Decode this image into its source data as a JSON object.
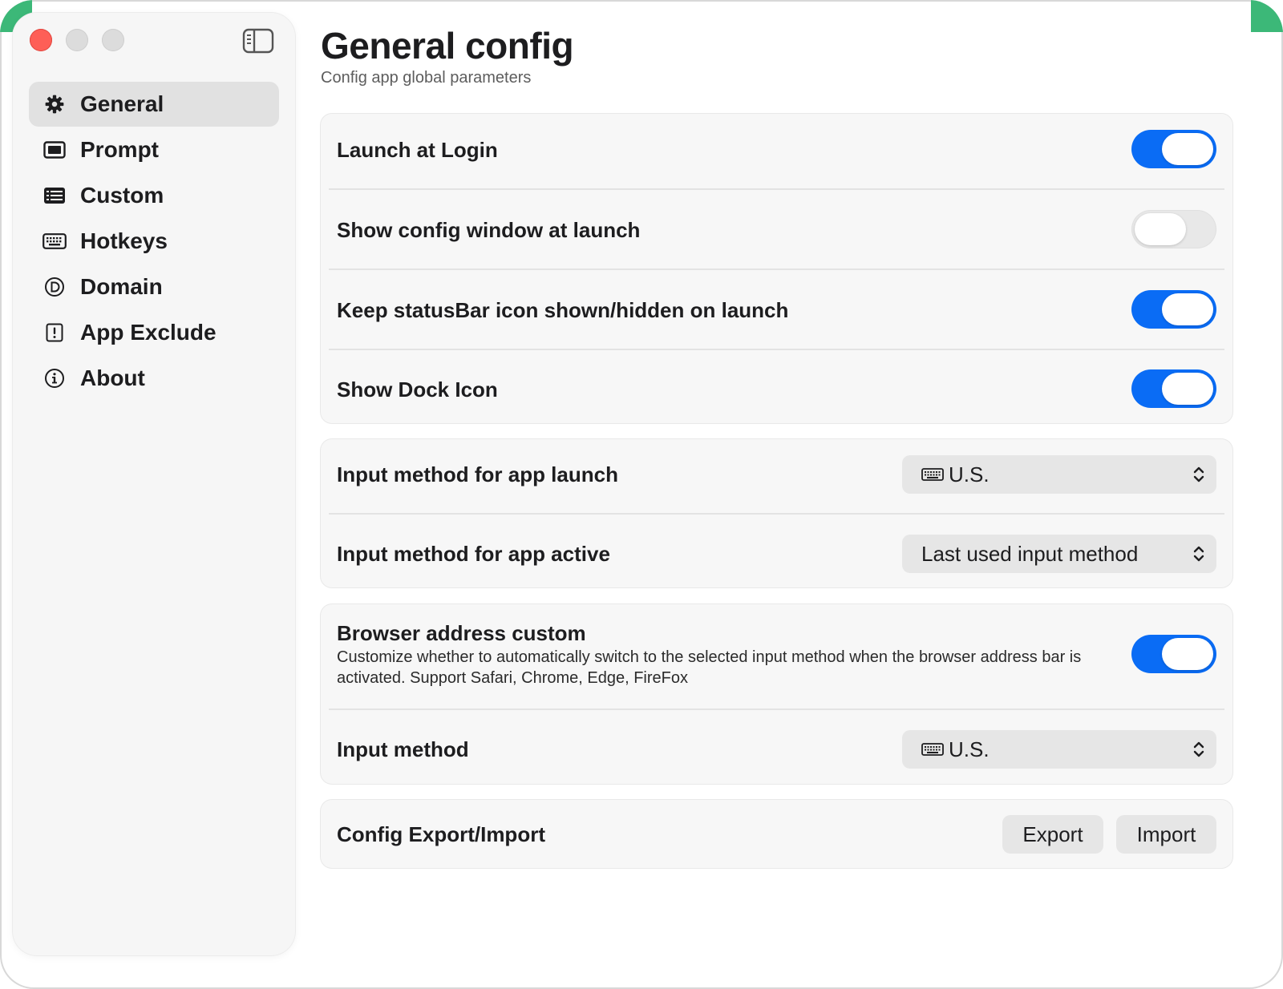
{
  "window": {
    "sidebar_toggle_icon": "sidebar-left-icon"
  },
  "sidebar": {
    "items": [
      {
        "label": "General",
        "icon": "gear-icon",
        "active": true
      },
      {
        "label": "Prompt",
        "icon": "display-icon",
        "active": false
      },
      {
        "label": "Custom",
        "icon": "list-rectangle-icon",
        "active": false
      },
      {
        "label": "Hotkeys",
        "icon": "keyboard-icon",
        "active": false
      },
      {
        "label": "Domain",
        "icon": "circle-d-icon",
        "active": false
      },
      {
        "label": "App Exclude",
        "icon": "exclamation-square-icon",
        "active": false
      },
      {
        "label": "About",
        "icon": "info-circle-icon",
        "active": false
      }
    ]
  },
  "header": {
    "title": "General config",
    "subtitle": "Config app global parameters"
  },
  "launch_card": {
    "launch_at_login": {
      "label": "Launch at Login",
      "on": true
    },
    "show_config_window": {
      "label": "Show config window at launch",
      "on": false
    },
    "keep_statusbar_icon": {
      "label": "Keep statusBar icon shown/hidden on launch",
      "on": true
    },
    "show_dock_icon": {
      "label": "Show Dock Icon",
      "on": true
    }
  },
  "input_card": {
    "app_launch": {
      "label": "Input method for app launch",
      "value": "U.S.",
      "icon": "keyboard-icon"
    },
    "app_active": {
      "label": "Input method for app active",
      "value": "Last used input method"
    }
  },
  "browser_card": {
    "address_custom": {
      "label": "Browser address custom",
      "description": "Customize whether to automatically switch to the selected input method when the browser address bar is activated. Support Safari, Chrome, Edge, FireFox",
      "on": true
    },
    "input_method": {
      "label": "Input method",
      "value": "U.S.",
      "icon": "keyboard-icon"
    }
  },
  "export_card": {
    "label": "Config Export/Import",
    "export_label": "Export",
    "import_label": "Import"
  },
  "colors": {
    "accent": "#0a6cf5",
    "close": "#fe5f57",
    "sidebar_active": "#e1e1e1"
  }
}
